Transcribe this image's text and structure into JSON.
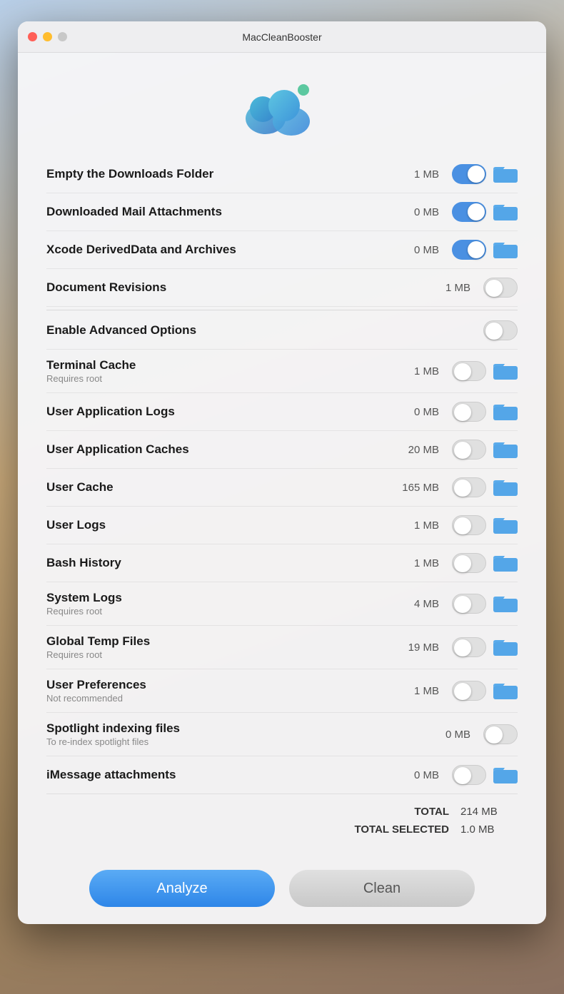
{
  "window": {
    "title": "MacCleanBooster"
  },
  "buttons": {
    "analyze": "Analyze",
    "clean": "Clean"
  },
  "totals": {
    "total_label": "TOTAL",
    "total_value": "214 MB",
    "total_selected_label": "TOTAL SELECTED",
    "total_selected_value": "1.0 MB"
  },
  "items": [
    {
      "label": "Empty the Downloads Folder",
      "sublabel": "",
      "size": "1 MB",
      "toggle": "on",
      "folder": true
    },
    {
      "label": "Downloaded Mail Attachments",
      "sublabel": "",
      "size": "0 MB",
      "toggle": "on",
      "folder": true
    },
    {
      "label": "Xcode DerivedData and Archives",
      "sublabel": "",
      "size": "0 MB",
      "toggle": "on",
      "folder": true
    },
    {
      "label": "Document Revisions",
      "sublabel": "",
      "size": "1 MB",
      "toggle": "off",
      "folder": false
    },
    {
      "label": "Enable Advanced Options",
      "sublabel": "",
      "size": "",
      "toggle": "off",
      "folder": false,
      "advanced": true
    },
    {
      "label": "Terminal Cache",
      "sublabel": "Requires root",
      "size": "1 MB",
      "toggle": "off",
      "folder": true
    },
    {
      "label": "User Application Logs",
      "sublabel": "",
      "size": "0 MB",
      "toggle": "off",
      "folder": true
    },
    {
      "label": "User Application Caches",
      "sublabel": "",
      "size": "20 MB",
      "toggle": "off",
      "folder": true
    },
    {
      "label": "User Cache",
      "sublabel": "",
      "size": "165 MB",
      "toggle": "off",
      "folder": true
    },
    {
      "label": "User Logs",
      "sublabel": "",
      "size": "1 MB",
      "toggle": "off",
      "folder": true
    },
    {
      "label": "Bash History",
      "sublabel": "",
      "size": "1 MB",
      "toggle": "off",
      "folder": true
    },
    {
      "label": "System Logs",
      "sublabel": "Requires root",
      "size": "4 MB",
      "toggle": "off",
      "folder": true
    },
    {
      "label": "Global Temp Files",
      "sublabel": "Requires root",
      "size": "19 MB",
      "toggle": "off",
      "folder": true
    },
    {
      "label": "User Preferences",
      "sublabel": "Not recommended",
      "size": "1 MB",
      "toggle": "off",
      "folder": true
    },
    {
      "label": "Spotlight indexing files",
      "sublabel": "To re-index spotlight files",
      "size": "0 MB",
      "toggle": "off",
      "folder": false
    },
    {
      "label": "iMessage attachments",
      "sublabel": "",
      "size": "0 MB",
      "toggle": "off",
      "folder": true
    }
  ]
}
